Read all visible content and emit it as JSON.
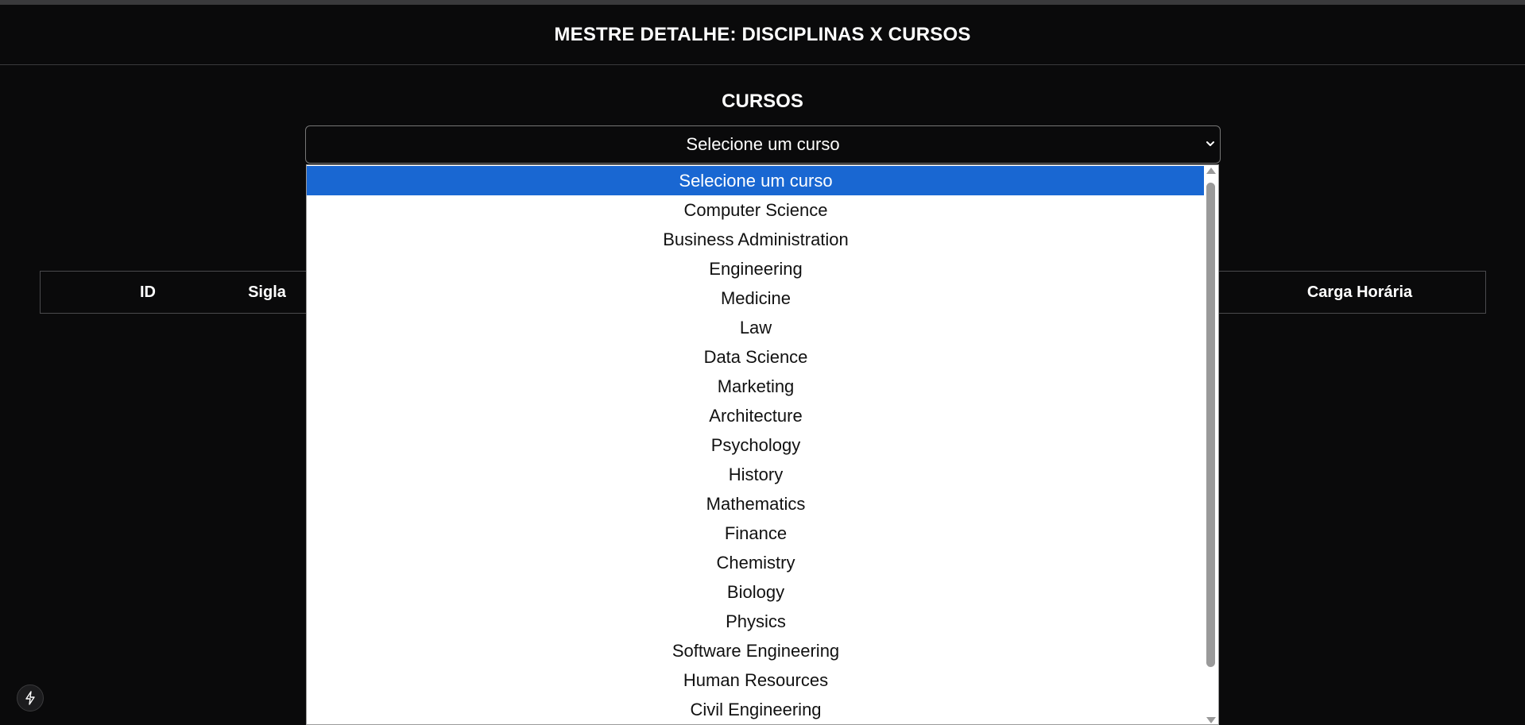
{
  "header": {
    "title": "MESTRE DETALHE: DISCIPLINAS X CURSOS"
  },
  "courses": {
    "title": "CURSOS",
    "select_value": "Selecione um curso",
    "options": [
      "Selecione um curso",
      "Computer Science",
      "Business Administration",
      "Engineering",
      "Medicine",
      "Law",
      "Data Science",
      "Marketing",
      "Architecture",
      "Psychology",
      "History",
      "Mathematics",
      "Finance",
      "Chemistry",
      "Biology",
      "Physics",
      "Software Engineering",
      "Human Resources",
      "Civil Engineering"
    ],
    "selected_index": 0
  },
  "table": {
    "columns": {
      "id": "ID",
      "sigla": "Sigla",
      "carga": "Carga Horária"
    }
  },
  "colors": {
    "background": "#0a0a0b",
    "selection": "#1967d2",
    "dropdown_bg": "#ffffff"
  },
  "icons": {
    "dev_badge": "lightning-icon",
    "select_arrow": "chevron-down-icon"
  }
}
